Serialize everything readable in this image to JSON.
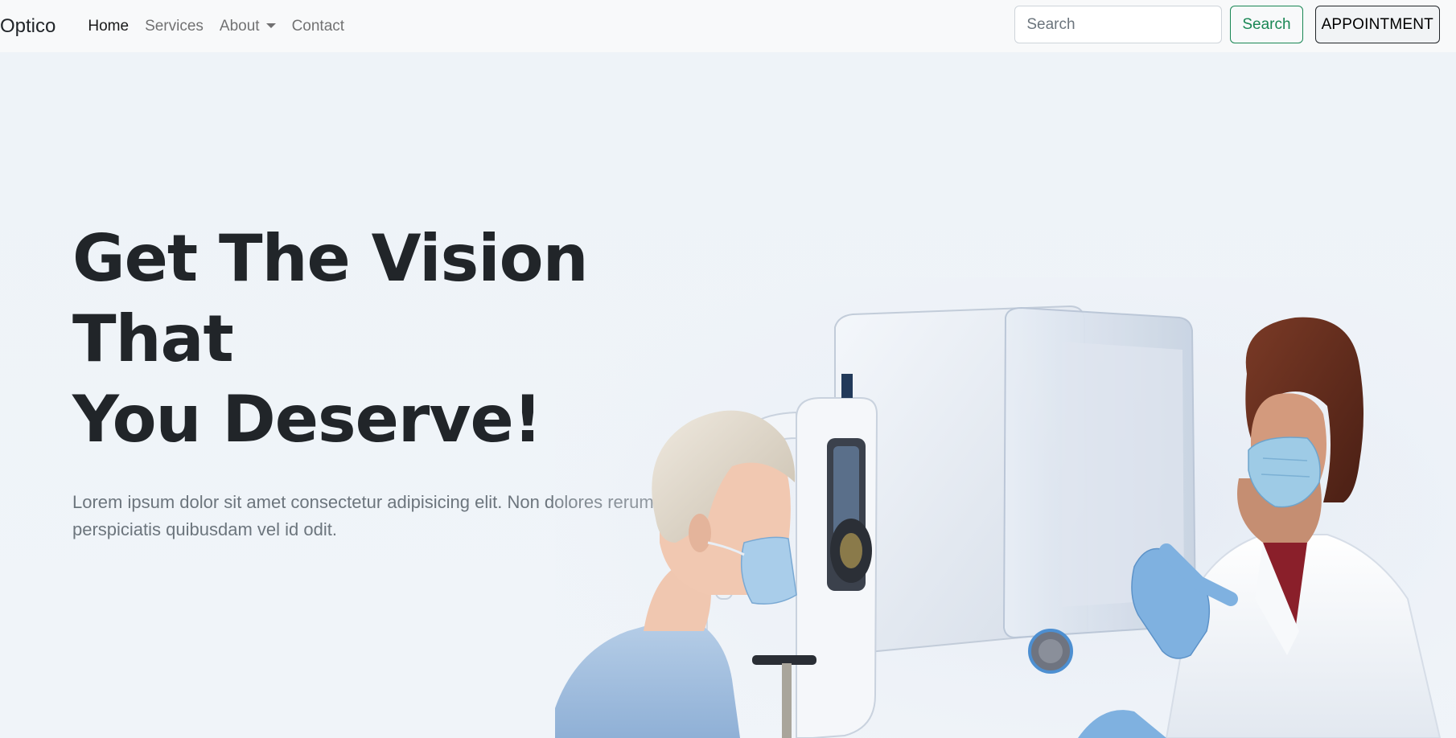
{
  "navbar": {
    "brand": "Optico",
    "links": [
      {
        "label": "Home"
      },
      {
        "label": "Services"
      },
      {
        "label": "About"
      },
      {
        "label": "Contact"
      }
    ],
    "search": {
      "placeholder": "Search",
      "button_label": "Search"
    },
    "appointment_label": "APPOINTMENT"
  },
  "hero": {
    "title_line1": "Get The Vision That",
    "title_line2": "You Deserve!",
    "subtitle": "Lorem ipsum dolor sit amet consectetur adipisicing elit. Non dolores rerum, a perspiciatis quibusdam vel id odit.",
    "image_icon": "eye-exam-illustration"
  },
  "colors": {
    "background": "#eff3f8",
    "navbar": "#f8f9fa",
    "success": "#198754",
    "text_dark": "#212529",
    "text_muted": "#6c757d"
  }
}
